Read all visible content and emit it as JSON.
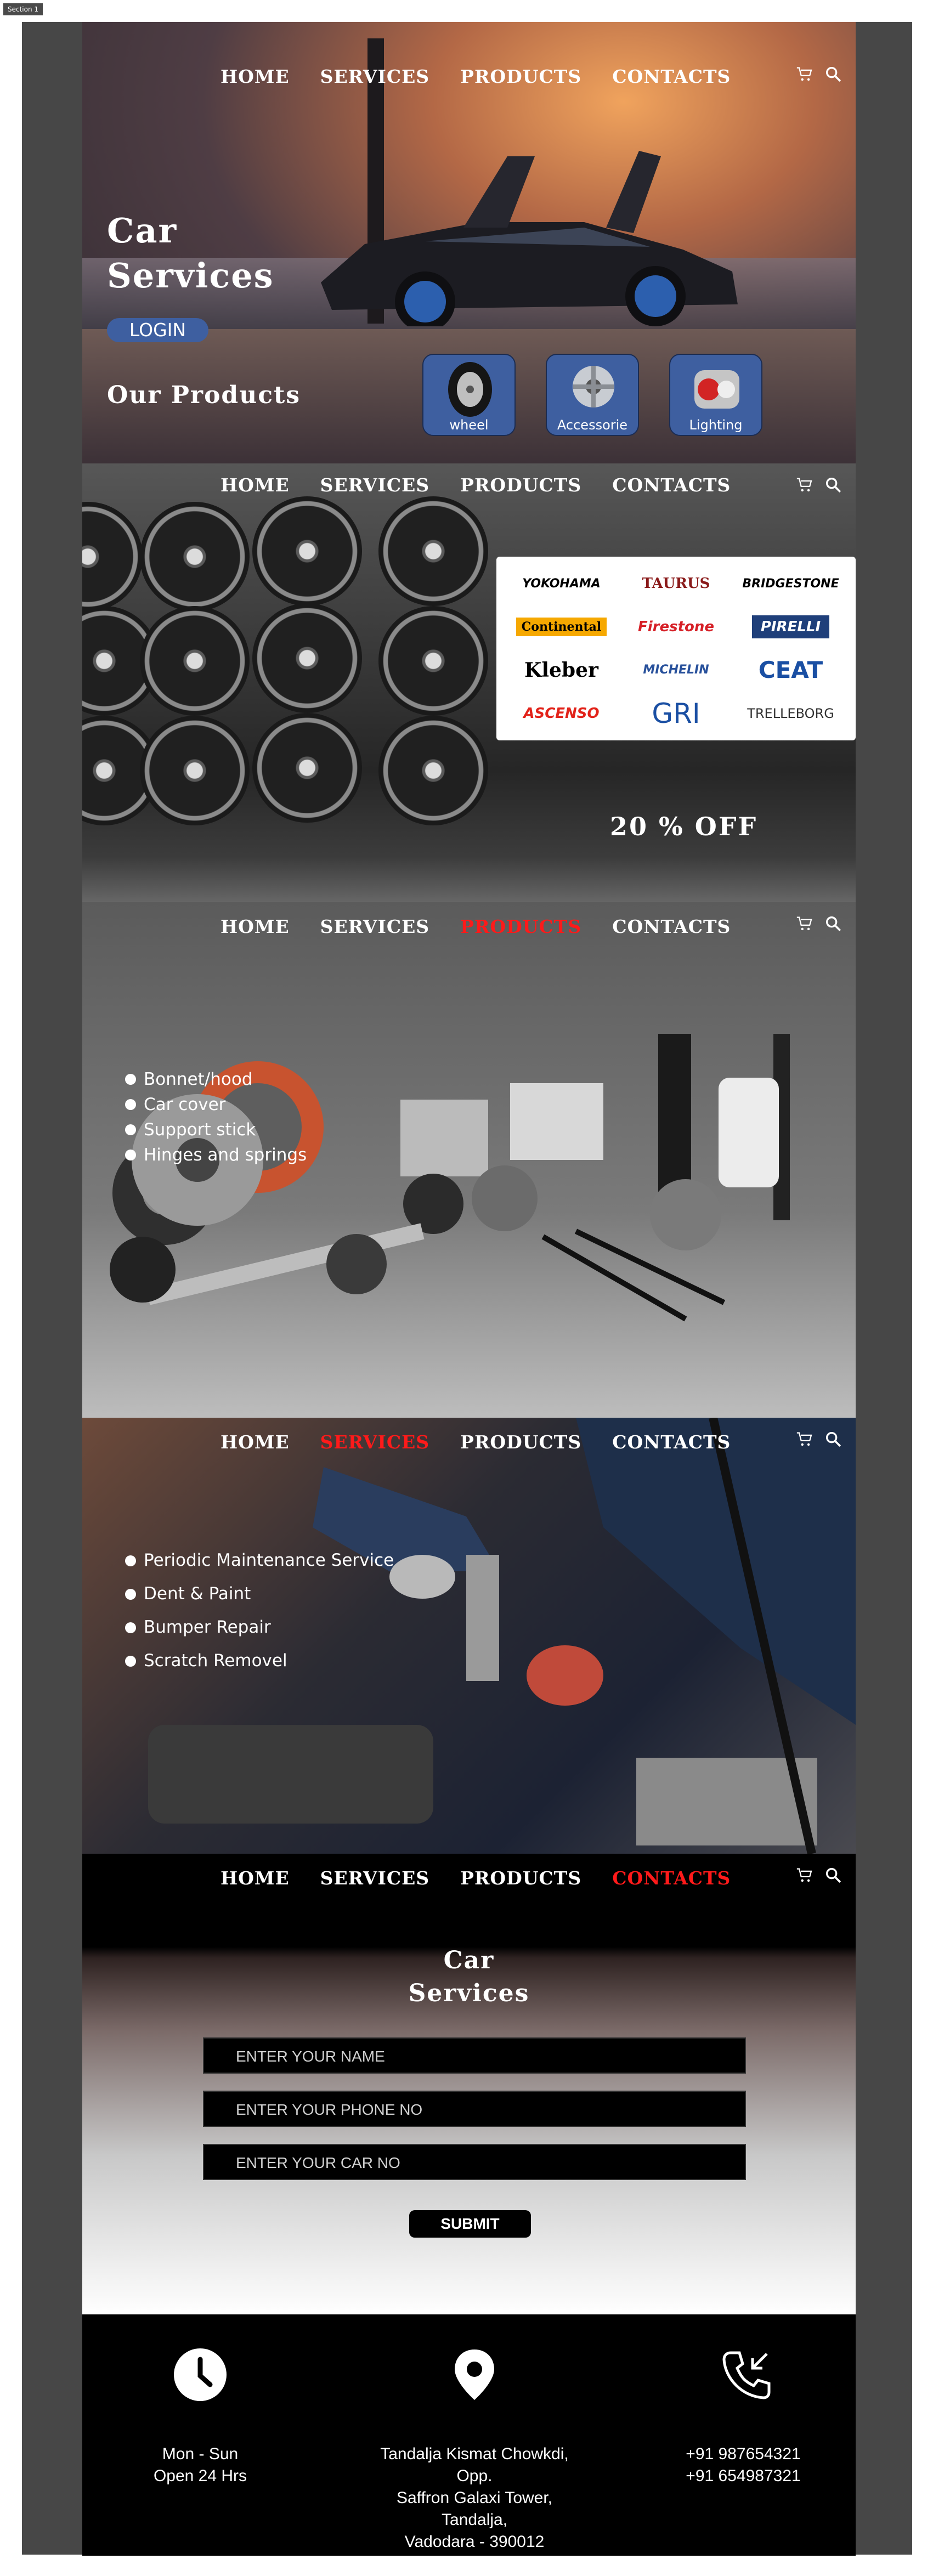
{
  "page_tag": "Section 1",
  "nav": {
    "home": "HOME",
    "services": "SERVICES",
    "products": "PRODUCTS",
    "contacts": "CONTACTS",
    "active_color": "#ff1a1a"
  },
  "icons": {
    "cart": "cart-icon",
    "search": "search-icon"
  },
  "hero": {
    "title_line1": "Car",
    "title_line2": "Services",
    "login": "LOGIN",
    "our_products": "Our Products",
    "products": [
      {
        "label": "wheel",
        "icon": "wheel-icon"
      },
      {
        "label": "Accessorie",
        "icon": "accessories-icon"
      },
      {
        "label": "Lighting",
        "icon": "lighting-icon"
      }
    ]
  },
  "brands_section": {
    "brands": [
      {
        "name": "YOKOHAMA",
        "color": "#111111"
      },
      {
        "name": "TAURUS",
        "color": "#111111"
      },
      {
        "name": "BRIDGESTONE",
        "color": "#111111"
      },
      {
        "name": "Continental",
        "color": "#111111"
      },
      {
        "name": "Firestone",
        "color": "#d61f26"
      },
      {
        "name": "PIRELLI",
        "color": "#ffffff"
      },
      {
        "name": "Kleber",
        "color": "#111111"
      },
      {
        "name": "MICHELIN",
        "color": "#27509b"
      },
      {
        "name": "CEAT",
        "color": "#1a4fa3"
      },
      {
        "name": "ASCENSO",
        "color": "#e2231a"
      },
      {
        "name": "GRI",
        "color": "#1a4fa3"
      },
      {
        "name": "TRELLEBORG",
        "color": "#333333"
      }
    ],
    "discount": "20 % OFF"
  },
  "products_section": {
    "items": [
      "Bonnet/hood",
      "Car cover",
      "Support stick",
      "Hinges and springs"
    ]
  },
  "services_section": {
    "items": [
      "Periodic Maintenance Service",
      "Dent & Paint",
      "Bumper Repair",
      "Scratch Removel"
    ]
  },
  "contact_form": {
    "title_line1": "Car",
    "title_line2": "Services",
    "name_placeholder": "ENTER YOUR NAME",
    "phone_placeholder": "ENTER YOUR PHONE NO",
    "car_placeholder": "ENTER YOUR CAR NO",
    "submit": "SUBMIT"
  },
  "footer": {
    "hours_line1": "Mon - Sun",
    "hours_line2": "Open 24 Hrs",
    "address_line1": "Tandalja Kismat Chowkdi, Opp.",
    "address_line2": "Saffron Galaxi Tower, Tandalja,",
    "address_line3": "Vadodara - 390012",
    "phone1": "+91 987654321",
    "phone2": "+91 654987321"
  }
}
